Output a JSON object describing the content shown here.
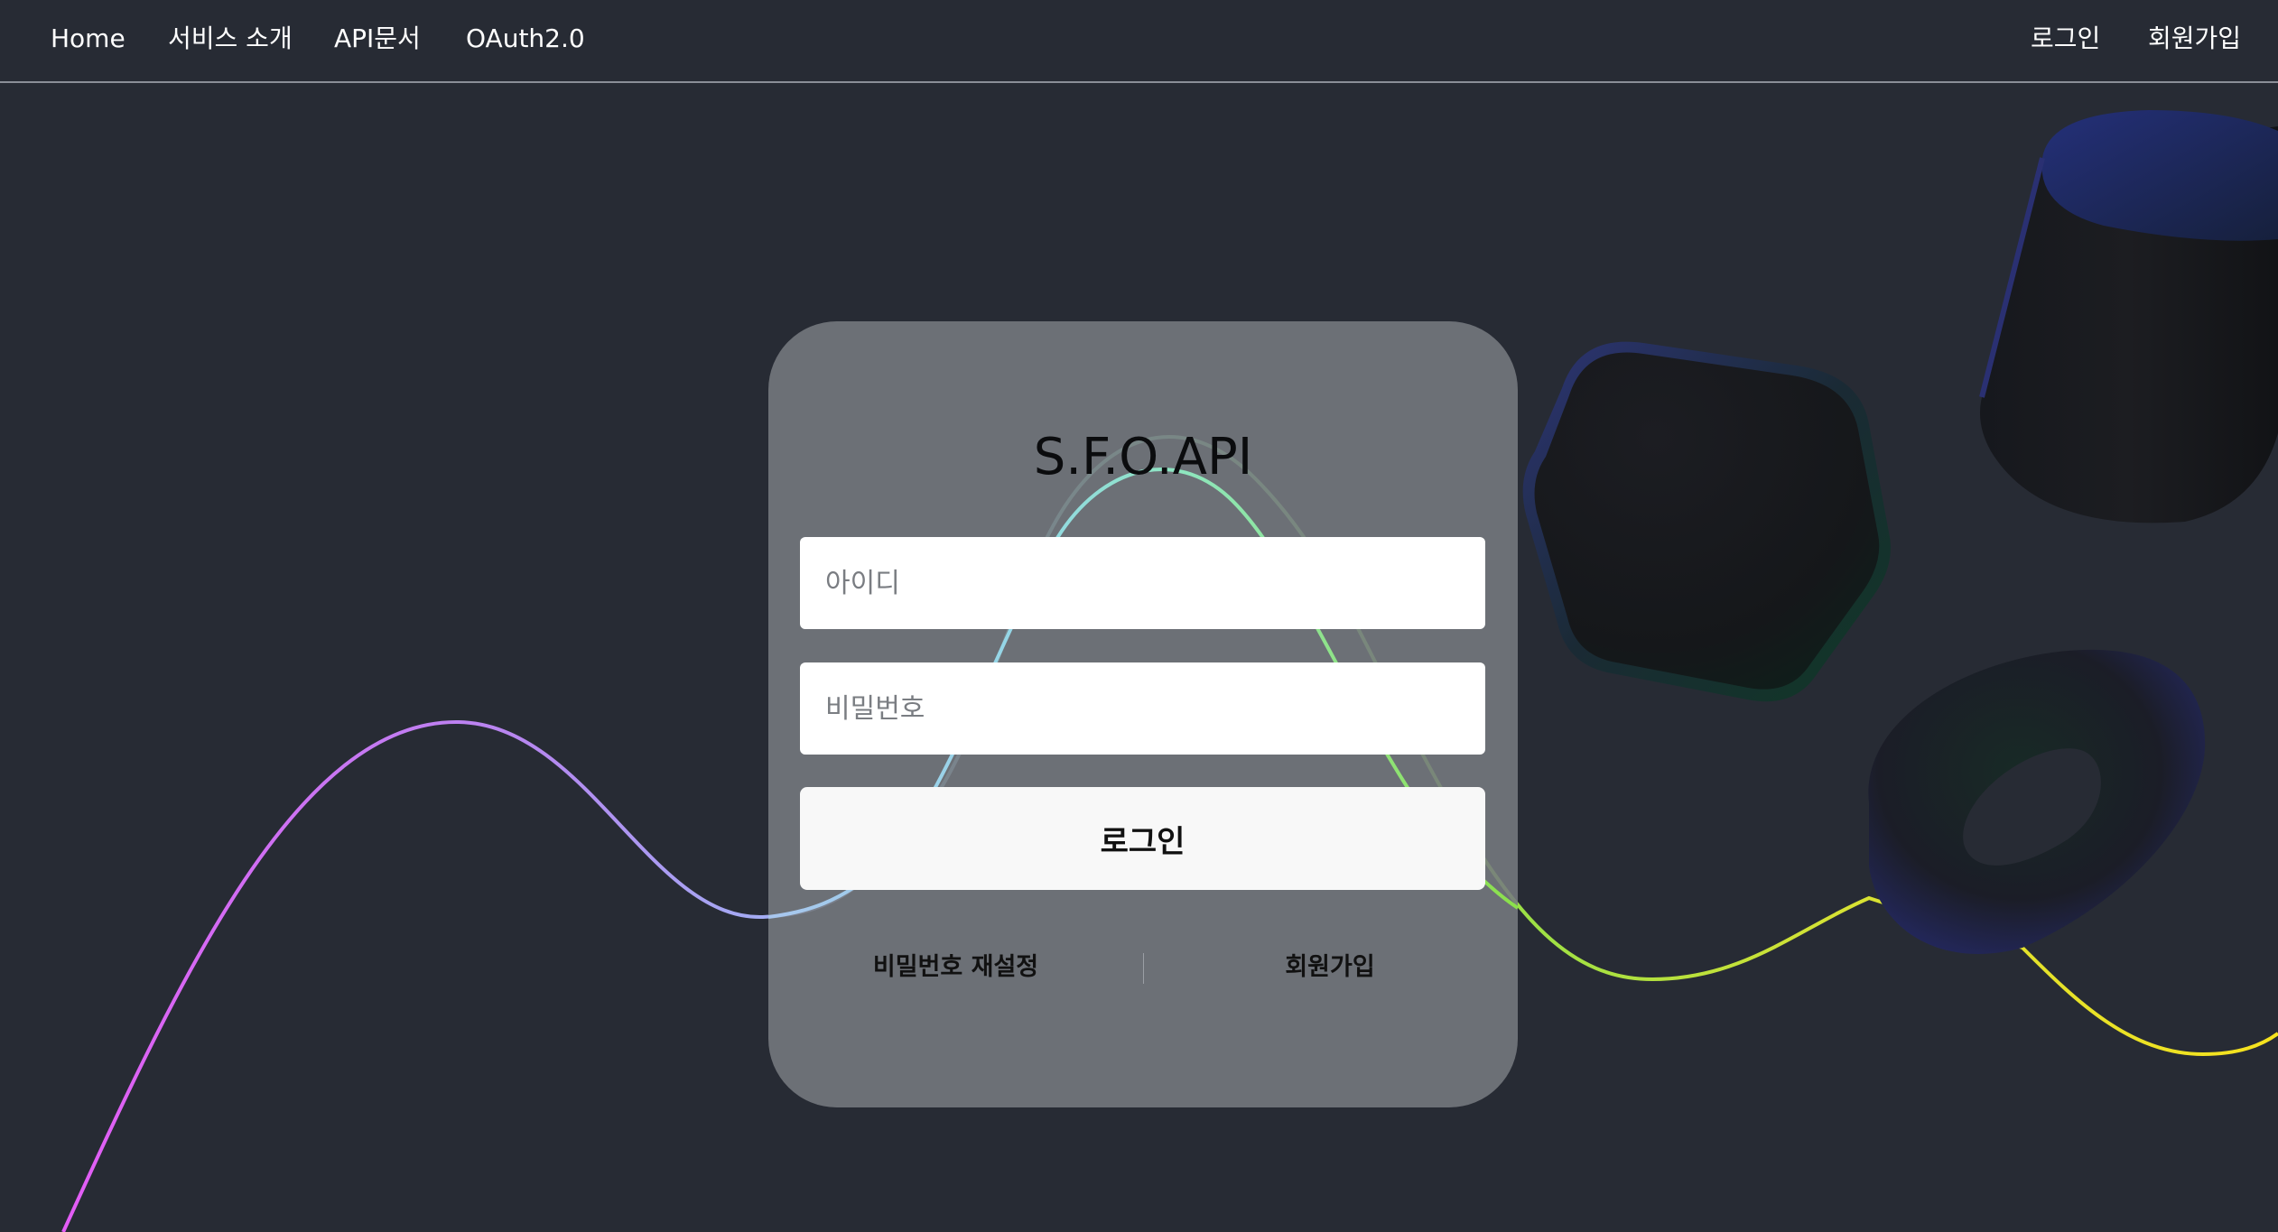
{
  "nav": {
    "home": "Home",
    "about": "서비스 소개",
    "api_docs": "API문서",
    "oauth": "OAuth2.0",
    "login": "로그인",
    "signup": "회원가입"
  },
  "login_card": {
    "title": "S.F.O.API",
    "id_placeholder": "아이디",
    "password_placeholder": "비밀번호",
    "login_button": "로그인",
    "reset_password_link": "비밀번호 재설정",
    "signup_link": "회원가입"
  },
  "theme": {
    "background": "#272b34",
    "card": "#6c7076",
    "wave_colors": [
      "#e35cf5",
      "#9fb4f4",
      "#7fe8c3",
      "#8be04a",
      "#f0e42a"
    ]
  }
}
